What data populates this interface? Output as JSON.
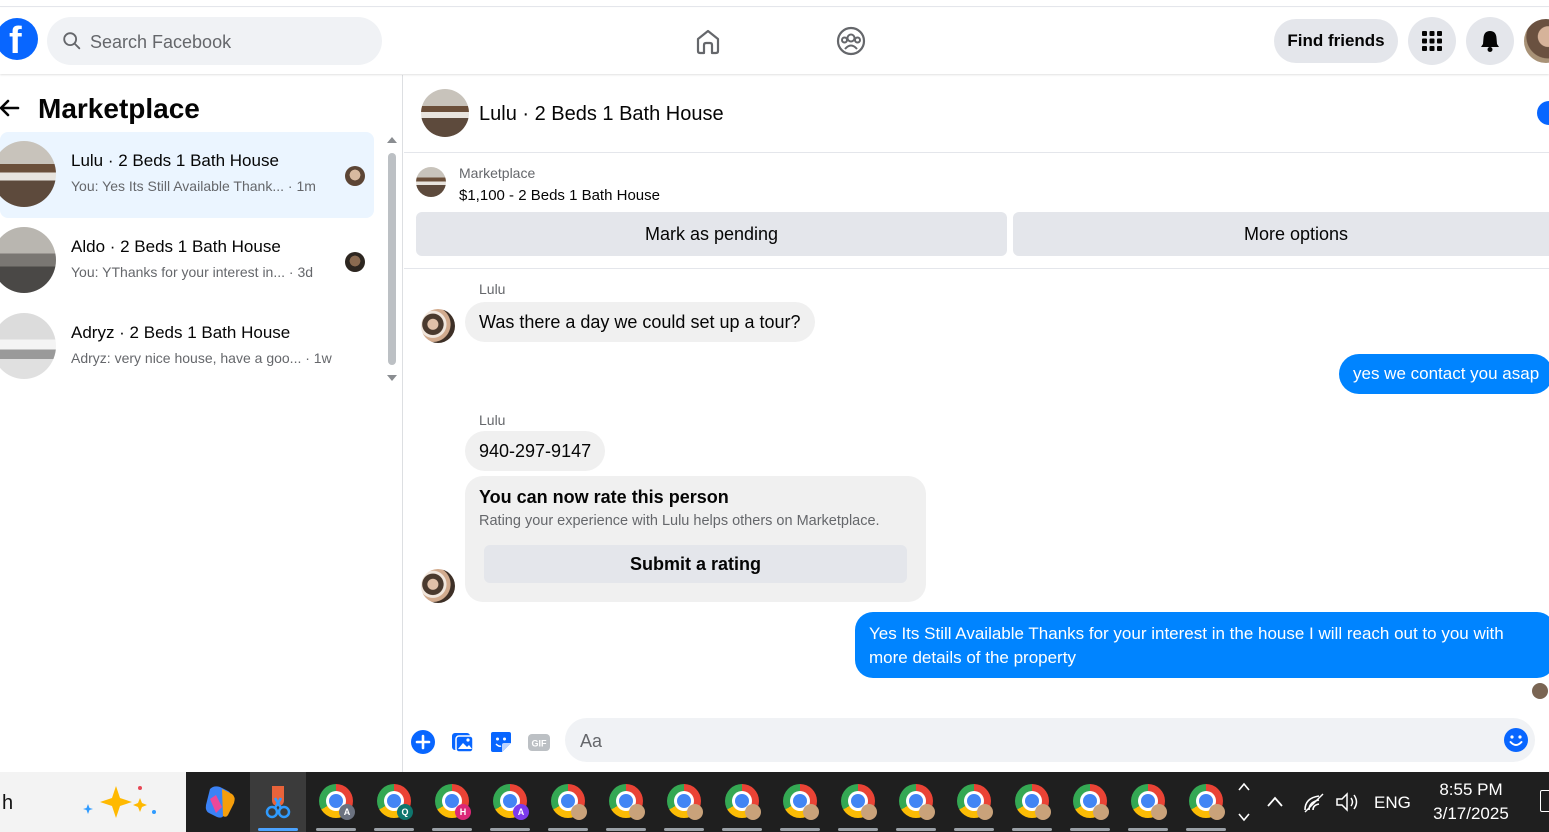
{
  "header": {
    "search_placeholder": "Search Facebook",
    "find_friends_label": "Find friends",
    "brand_color": "#0866ff",
    "icons": [
      "facebook-logo",
      "search-icon",
      "home-icon",
      "groups-icon",
      "menu-grid-icon",
      "notifications-bell-icon",
      "profile-avatar"
    ]
  },
  "sidebar": {
    "title": "Marketplace",
    "conversations": [
      {
        "name": "Lulu · 2 Beds 1 Bath House",
        "preview": "You: Yes Its Still Available Thank... · 1m",
        "active": true
      },
      {
        "name": "Aldo · 2 Beds 1 Bath House",
        "preview": "You: YThanks for your interest in... · 3d",
        "active": false
      },
      {
        "name": "Adryz · 2 Beds 1 Bath House",
        "preview": "Adryz: very nice house, have a goo... · 1w",
        "active": false
      }
    ]
  },
  "chat": {
    "title": "Lulu · 2 Beds 1 Bath House",
    "listing": {
      "label": "Marketplace",
      "price_title": "$1,100 - 2 Beds 1 Bath House",
      "mark_pending_label": "Mark as pending",
      "more_options_label": "More options"
    },
    "messages": [
      {
        "from": "Lulu",
        "sender_label": "Lulu",
        "text": "Was there a day we could set up a tour?"
      },
      {
        "from": "me",
        "text": "yes we contact you asap"
      },
      {
        "from": "Lulu",
        "sender_label": "Lulu",
        "text": "940-297-9147"
      },
      {
        "from": "me",
        "text": "Yes Its Still Available Thanks for your interest in the house  I will reach out to you with more details of the property"
      }
    ],
    "rating_card": {
      "heading": "You can now rate this person",
      "subtext": "Rating your experience with Lulu helps others on Marketplace.",
      "button_label": "Submit a rating"
    },
    "composer": {
      "placeholder": "Aa",
      "icons": [
        "plus-icon",
        "photo-icon",
        "sticker-icon",
        "gif-icon",
        "emoji-icon"
      ]
    },
    "outgoing_color": "#0084ff"
  },
  "taskbar": {
    "search_text": "h",
    "app_badges": [
      "A",
      "Q",
      "H",
      "A",
      "",
      "",
      "",
      "",
      "",
      "",
      "",
      "",
      "",
      "",
      "",
      ""
    ],
    "language": "ENG",
    "time": "8:55 PM",
    "date": "3/17/2025"
  }
}
